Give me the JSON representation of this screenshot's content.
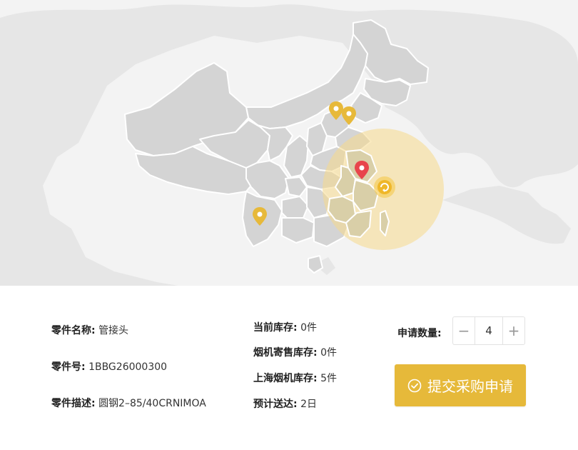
{
  "part": {
    "name_label": "零件名称:",
    "name_value": "管接头",
    "number_label": "零件号:",
    "number_value": "1BBG26000300",
    "desc_label": "零件描述:",
    "desc_value": "圆钢2–85/40CRNIMOA"
  },
  "stock": {
    "current_label": "当前库存:",
    "current_value": "0件",
    "consign_label": "烟机寄售库存:",
    "consign_value": "0件",
    "shanghai_label": "上海烟机库存:",
    "shanghai_value": "5件",
    "eta_label": "预计送达:",
    "eta_value": "2日"
  },
  "order": {
    "qty_label": "申请数量:",
    "qty_value": "4",
    "minus_symbol": "−",
    "plus_symbol": "+",
    "submit_label": "提交采购申请"
  },
  "colors": {
    "accent": "#e6b93a",
    "pin_yellow": "#e7b93a",
    "pin_red": "#e8454c",
    "land": "#d6d6d6",
    "background_land": "#e6e6e6"
  }
}
